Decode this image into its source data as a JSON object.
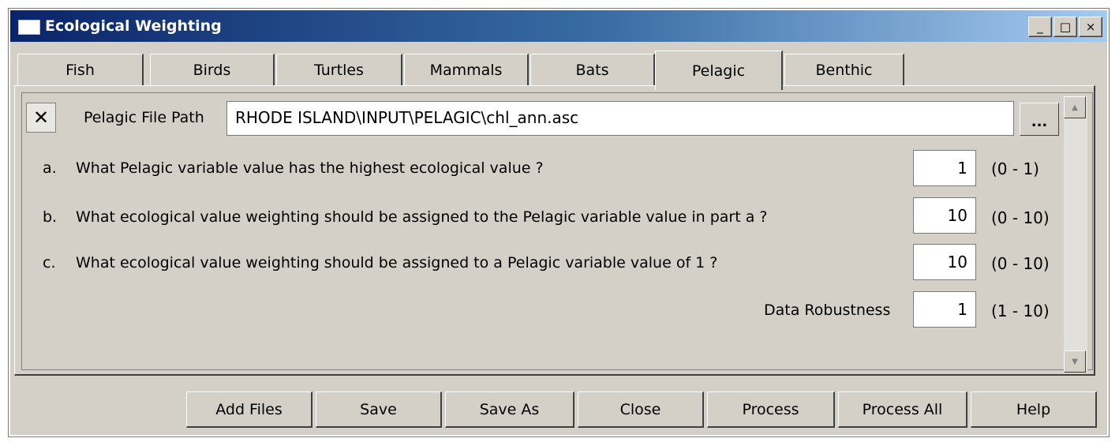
{
  "window": {
    "title": "Ecological Weighting",
    "minimize": "_",
    "maximize": "□",
    "close": "×"
  },
  "tabs": [
    {
      "label": "Fish"
    },
    {
      "label": "Birds"
    },
    {
      "label": "Turtles"
    },
    {
      "label": "Mammals"
    },
    {
      "label": "Bats"
    },
    {
      "label": "Pelagic",
      "active": true
    },
    {
      "label": "Benthic"
    }
  ],
  "file": {
    "remove_label": "✕",
    "path_label": "Pelagic File Path",
    "path_value": "RHODE ISLAND\\INPUT\\PELAGIC\\chl_ann.asc",
    "browse_label": "..."
  },
  "questions": [
    {
      "prefix": "a.",
      "text": "What Pelagic variable value has the highest ecological value ?",
      "value": "1",
      "range": "(0 - 1)"
    },
    {
      "prefix": "b.",
      "text": "What ecological value weighting should be assigned to the Pelagic variable value in part a ?",
      "value": "10",
      "range": "(0 - 10)"
    },
    {
      "prefix": "c.",
      "text": "What ecological value weighting should be assigned to a Pelagic variable value of 1 ?",
      "value": "10",
      "range": "(0 - 10)"
    }
  ],
  "robustness": {
    "label": "Data Robustness",
    "value": "1",
    "range": "(1 - 10)"
  },
  "scrollbar": {
    "up": "▲",
    "down": "▼"
  },
  "buttons": {
    "add_files": "Add Files",
    "save": "Save",
    "save_as": "Save As",
    "close": "Close",
    "process": "Process",
    "process_all": "Process All",
    "help": "Help"
  }
}
